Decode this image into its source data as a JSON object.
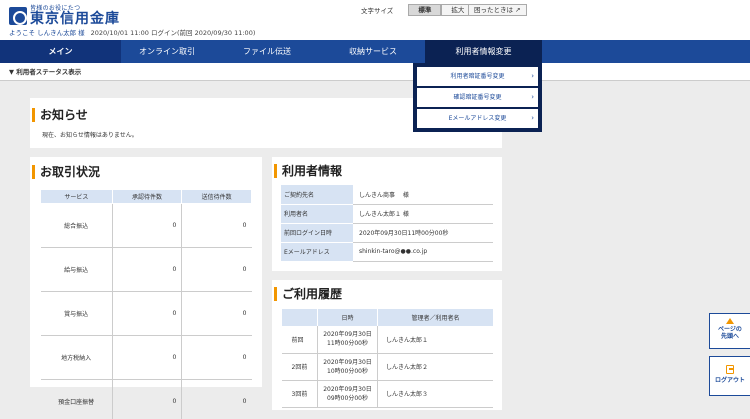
{
  "header": {
    "logo_sub": "皆様のお役にたつ",
    "logo_main": "東京信用金庫",
    "welcome": "ようこそ しんきん太郎 様",
    "login_info": "2020/10/01 11:00 ログイン(前回 2020/09/30 11:00)",
    "font_size_label": "文字サイズ",
    "font_standard": "標準",
    "font_large": "拡大",
    "help": "困ったときは"
  },
  "nav": {
    "items": [
      "メイン",
      "オンライン取引",
      "ファイル伝送",
      "収納サービス",
      "利用者情報変更"
    ]
  },
  "status_bar": "▼ 利用者ステータス表示",
  "dropdown": {
    "items": [
      "利用者暗証番号変更",
      "確認暗証番号変更",
      "Eメールアドレス変更"
    ]
  },
  "notice": {
    "title": "お知らせ",
    "message": "現在、お知らせ情報はありません。"
  },
  "transactions": {
    "title": "お取引状況",
    "headers": [
      "サービス",
      "承認待件数",
      "送信待件数"
    ],
    "rows": [
      {
        "service": "総合振込",
        "pending_approval": "0",
        "pending_send": "0"
      },
      {
        "service": "給与振込",
        "pending_approval": "0",
        "pending_send": "0"
      },
      {
        "service": "賞与振込",
        "pending_approval": "0",
        "pending_send": "0"
      },
      {
        "service": "地方税納入",
        "pending_approval": "0",
        "pending_send": "0"
      },
      {
        "service": "預金口座振替",
        "pending_approval": "0",
        "pending_send": "0"
      }
    ]
  },
  "user_info": {
    "title": "利用者情報",
    "rows": [
      {
        "label": "ご契約先名",
        "value": "しんきん商事　 様"
      },
      {
        "label": "利用者名",
        "value": "しんきん太郎１ 様"
      },
      {
        "label": "前回ログイン日時",
        "value": "2020年09月30日11時00分00秒"
      },
      {
        "label": "Eメールアドレス",
        "value": "shinkin-taro@●●.co.jp"
      }
    ]
  },
  "history": {
    "title": "ご利用履歴",
    "headers": [
      "",
      "日時",
      "管理者／利用者名"
    ],
    "rows": [
      {
        "round": "前回",
        "date": "2020年09月30日",
        "time": "11時00分00秒",
        "user": "しんきん太郎１"
      },
      {
        "round": "2回前",
        "date": "2020年09月30日",
        "time": "10時00分00秒",
        "user": "しんきん太郎２"
      },
      {
        "round": "3回前",
        "date": "2020年09月30日",
        "time": "09時00分00秒",
        "user": "しんきん太郎３"
      }
    ]
  },
  "side": {
    "page_top": [
      "ページの",
      "先頭へ"
    ],
    "logout": "ログアウト"
  },
  "colors": {
    "brand_blue": "#1c4a99",
    "accent_orange": "#f29600",
    "table_header": "#d7e3f3"
  }
}
